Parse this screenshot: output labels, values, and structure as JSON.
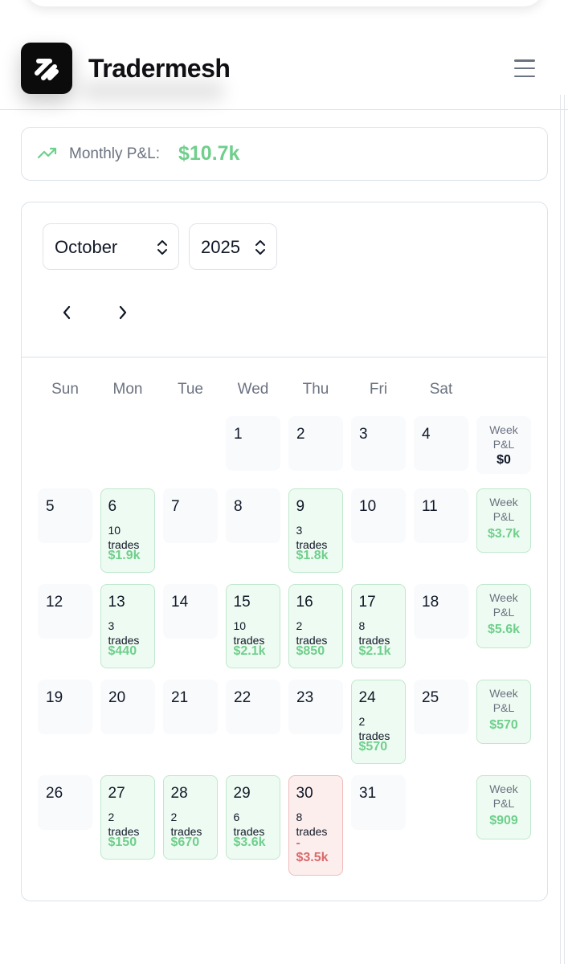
{
  "brand": {
    "name": "Tradermesh"
  },
  "summary": {
    "label": "Monthly P&L:",
    "value": "$10.7k"
  },
  "controls": {
    "month": "October",
    "year": "2025"
  },
  "weekdays": [
    "Sun",
    "Mon",
    "Tue",
    "Wed",
    "Thu",
    "Fri",
    "Sat"
  ],
  "week_label_line1": "Week",
  "week_label_line2": "P&L",
  "weeks": [
    {
      "days": [
        null,
        null,
        null,
        {
          "day": "1"
        },
        {
          "day": "2"
        },
        {
          "day": "3"
        },
        {
          "day": "4"
        }
      ],
      "pnl": "$0"
    },
    {
      "days": [
        {
          "day": "5"
        },
        {
          "day": "6",
          "trades": "10",
          "trades_word": "trades",
          "amount": "$1.9k",
          "status": "profit"
        },
        {
          "day": "7"
        },
        {
          "day": "8"
        },
        {
          "day": "9",
          "trades": "3",
          "trades_word": "trades",
          "amount": "$1.8k",
          "status": "profit"
        },
        {
          "day": "10"
        },
        {
          "day": "11"
        }
      ],
      "pnl": "$3.7k"
    },
    {
      "days": [
        {
          "day": "12"
        },
        {
          "day": "13",
          "trades": "3",
          "trades_word": "trades",
          "amount": "$440",
          "status": "profit"
        },
        {
          "day": "14"
        },
        {
          "day": "15",
          "trades": "10",
          "trades_word": "trades",
          "amount": "$2.1k",
          "status": "profit"
        },
        {
          "day": "16",
          "trades": "2",
          "trades_word": "trades",
          "amount": "$850",
          "status": "profit"
        },
        {
          "day": "17",
          "trades": "8",
          "trades_word": "trades",
          "amount": "$2.1k",
          "status": "profit"
        },
        {
          "day": "18"
        }
      ],
      "pnl": "$5.6k"
    },
    {
      "days": [
        {
          "day": "19"
        },
        {
          "day": "20"
        },
        {
          "day": "21"
        },
        {
          "day": "22"
        },
        {
          "day": "23"
        },
        {
          "day": "24",
          "trades": "2",
          "trades_word": "trades",
          "amount": "$570",
          "status": "profit"
        },
        {
          "day": "25"
        }
      ],
      "pnl": "$570"
    },
    {
      "days": [
        {
          "day": "26"
        },
        {
          "day": "27",
          "trades": "2",
          "trades_word": "trades",
          "amount": "$150",
          "status": "profit"
        },
        {
          "day": "28",
          "trades": "2",
          "trades_word": "trades",
          "amount": "$670",
          "status": "profit"
        },
        {
          "day": "29",
          "trades": "6",
          "trades_word": "trades",
          "amount": "$3.6k",
          "status": "profit"
        },
        {
          "day": "30",
          "trades": "8",
          "trades_word": "trades",
          "amount_sign": "-",
          "amount": "$3.5k",
          "status": "loss"
        },
        {
          "day": "31"
        },
        null
      ],
      "pnl": "$909"
    }
  ],
  "colors": {
    "profit": "#6fcf8c",
    "loss": "#d96b6b",
    "profit_bg": "#eefbf2",
    "loss_bg": "#fdeeee",
    "muted_text": "#6b7280"
  }
}
